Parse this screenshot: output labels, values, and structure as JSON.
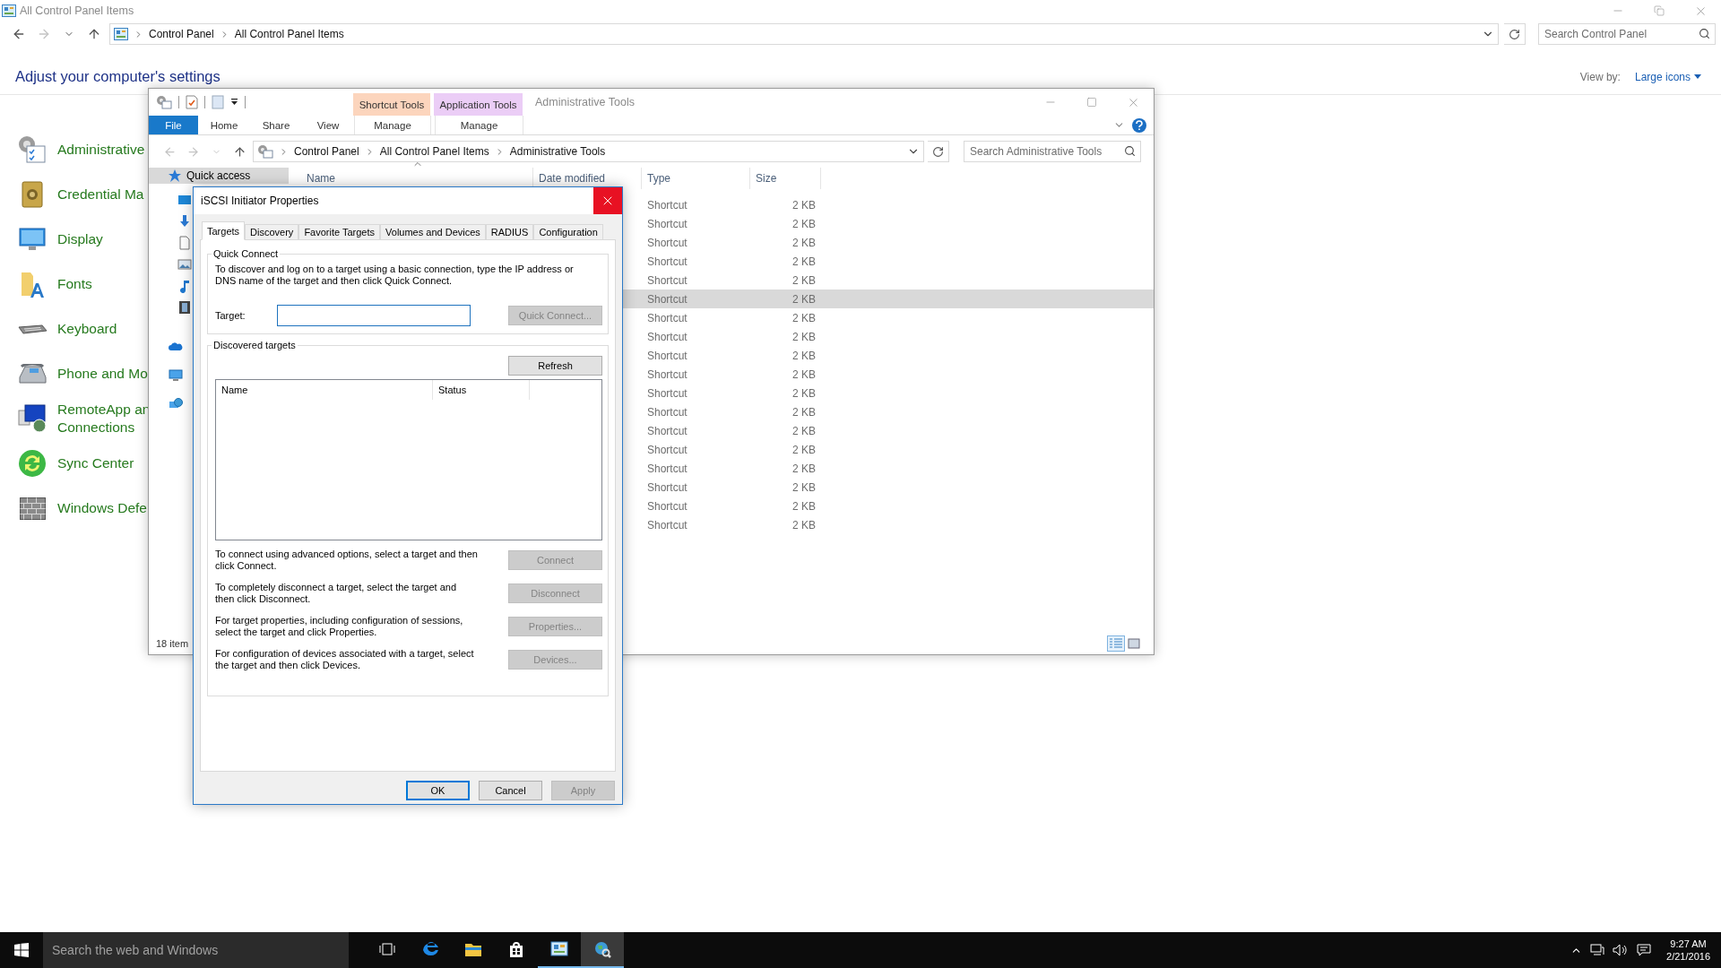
{
  "control_panel": {
    "title": "All Control Panel Items",
    "breadcrumb": [
      "Control Panel",
      "All Control Panel Items"
    ],
    "search_placeholder": "Search Control Panel",
    "heading": "Adjust your computer's settings",
    "view_by_label": "View by:",
    "view_by_value": "Large icons",
    "items": [
      {
        "lines": [
          "Administrative"
        ]
      },
      {
        "lines": [
          "Credential Ma"
        ]
      },
      {
        "lines": [
          "Display"
        ]
      },
      {
        "lines": [
          "Fonts"
        ]
      },
      {
        "lines": [
          "Keyboard"
        ]
      },
      {
        "lines": [
          "Phone and Mo"
        ]
      },
      {
        "lines": [
          "RemoteApp an",
          "Connections"
        ]
      },
      {
        "lines": [
          "Sync Center"
        ]
      },
      {
        "lines": [
          "Windows Defe"
        ]
      }
    ]
  },
  "explorer": {
    "title": "Administrative Tools",
    "context_tabs": [
      {
        "label": "Shortcut Tools",
        "color": "#fcd5bd",
        "tab": "Manage"
      },
      {
        "label": "Application Tools",
        "color": "#ebcdf6",
        "tab": "Manage"
      }
    ],
    "ribbon_tabs": [
      {
        "label": "File",
        "kind": "file"
      },
      {
        "label": "Home",
        "kind": "tab"
      },
      {
        "label": "Share",
        "kind": "tab"
      },
      {
        "label": "View",
        "kind": "tab"
      }
    ],
    "breadcrumb": [
      "Control Panel",
      "All Control Panel Items",
      "Administrative Tools"
    ],
    "search_placeholder": "Search Administrative Tools",
    "nav": [
      {
        "label": "Quick access",
        "selected": true
      }
    ],
    "columns": [
      "Name",
      "Date modified",
      "Type",
      "Size"
    ],
    "rows": [
      {
        "type": "Shortcut",
        "size": "2 KB",
        "selected": false
      },
      {
        "type": "Shortcut",
        "size": "2 KB",
        "selected": false
      },
      {
        "type": "Shortcut",
        "size": "2 KB",
        "selected": false
      },
      {
        "type": "Shortcut",
        "size": "2 KB",
        "selected": false
      },
      {
        "type": "Shortcut",
        "size": "2 KB",
        "selected": false
      },
      {
        "type": "Shortcut",
        "size": "2 KB",
        "selected": true
      },
      {
        "type": "Shortcut",
        "size": "2 KB",
        "selected": false
      },
      {
        "type": "Shortcut",
        "size": "2 KB",
        "selected": false
      },
      {
        "type": "Shortcut",
        "size": "2 KB",
        "selected": false
      },
      {
        "type": "Shortcut",
        "size": "2 KB",
        "selected": false
      },
      {
        "type": "Shortcut",
        "size": "2 KB",
        "selected": false
      },
      {
        "type": "Shortcut",
        "size": "2 KB",
        "selected": false
      },
      {
        "type": "Shortcut",
        "size": "2 KB",
        "selected": false
      },
      {
        "type": "Shortcut",
        "size": "2 KB",
        "selected": false
      },
      {
        "type": "Shortcut",
        "size": "2 KB",
        "selected": false
      },
      {
        "type": "Shortcut",
        "size": "2 KB",
        "selected": false
      },
      {
        "type": "Shortcut",
        "size": "2 KB",
        "selected": false
      },
      {
        "type": "Shortcut",
        "size": "2 KB",
        "selected": false
      }
    ],
    "status": "18 item"
  },
  "dialog": {
    "title": "iSCSI Initiator Properties",
    "tabs": [
      {
        "label": "Targets",
        "selected": true
      },
      {
        "label": "Discovery",
        "selected": false
      },
      {
        "label": "Favorite Targets",
        "selected": false
      },
      {
        "label": "Volumes and Devices",
        "selected": false
      },
      {
        "label": "RADIUS",
        "selected": false
      },
      {
        "label": "Configuration",
        "selected": false
      }
    ],
    "quick_connect": {
      "legend": "Quick Connect",
      "lines": [
        "To discover and log on to a target using a basic connection, type the IP address or",
        "DNS name of the target and then click Quick Connect."
      ],
      "target_label": "Target:",
      "button": {
        "label": "Quick Connect...",
        "disabled": true
      }
    },
    "discovered": {
      "legend": "Discovered targets",
      "refresh": {
        "label": "Refresh",
        "disabled": false
      },
      "columns": [
        "Name",
        "Status"
      ],
      "actions": [
        {
          "lines": [
            "To connect using advanced options, select a target and then",
            "click Connect."
          ],
          "button": {
            "label": "Connect",
            "disabled": true
          }
        },
        {
          "lines": [
            "To completely disconnect a target, select the target and",
            "then click Disconnect."
          ],
          "button": {
            "label": "Disconnect",
            "disabled": true
          }
        },
        {
          "lines": [
            "For target properties, including configuration of sessions,",
            "select the target and click Properties."
          ],
          "button": {
            "label": "Properties...",
            "disabled": true
          }
        },
        {
          "lines": [
            "For configuration of devices associated with a target, select",
            "the target and then click Devices."
          ],
          "button": {
            "label": "Devices...",
            "disabled": true
          }
        }
      ]
    },
    "buttons": [
      {
        "label": "OK",
        "default": true,
        "disabled": false
      },
      {
        "label": "Cancel",
        "default": false,
        "disabled": false
      },
      {
        "label": "Apply",
        "default": false,
        "disabled": true
      }
    ]
  },
  "taskbar": {
    "search_placeholder": "Search the web and Windows",
    "apps": [
      {
        "running": false,
        "selected": false
      },
      {
        "running": false,
        "selected": false
      },
      {
        "running": false,
        "selected": false
      },
      {
        "running": true,
        "selected": false
      },
      {
        "running": true,
        "selected": true
      }
    ],
    "time": "9:27 AM",
    "date": "2/21/2016"
  }
}
